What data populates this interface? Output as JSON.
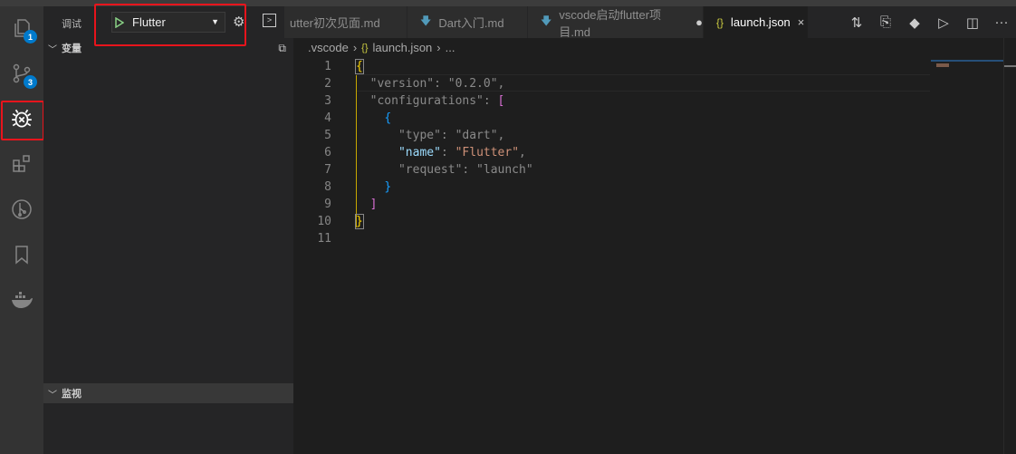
{
  "activity_bar": [
    {
      "name": "explorer",
      "badge": "1"
    },
    {
      "name": "source-control",
      "badge": "3"
    },
    {
      "name": "debug"
    },
    {
      "name": "extensions"
    },
    {
      "name": "gitlens"
    },
    {
      "name": "bookmarks"
    },
    {
      "name": "docker"
    }
  ],
  "sidebar": {
    "title": "调试",
    "config_name": "Flutter",
    "variables_label": "变量",
    "watch_label": "监视"
  },
  "tabs": [
    {
      "label": "utter初次见面.md"
    },
    {
      "label": "Dart入门.md"
    },
    {
      "label": "vscode启动flutter项目.md",
      "dirty": "●"
    },
    {
      "label": "launch.json",
      "close": "×",
      "active": true
    }
  ],
  "breadcrumb": {
    "folder": ".vscode",
    "file": "launch.json",
    "more": "..."
  },
  "code": {
    "line_numbers": [
      "1",
      "2",
      "3",
      "4",
      "5",
      "6",
      "7",
      "8",
      "9",
      "10",
      "11"
    ]
  }
}
